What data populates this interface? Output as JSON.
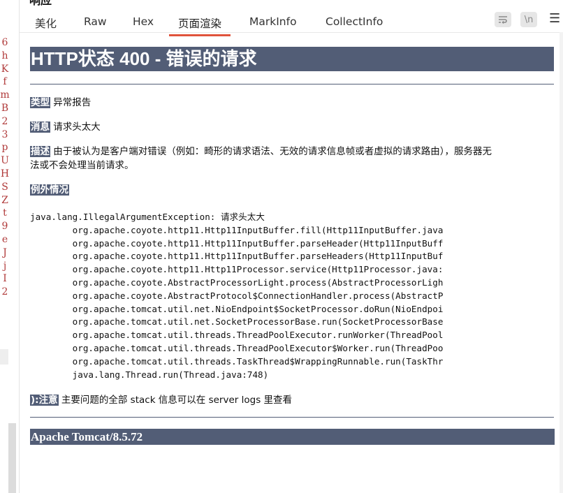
{
  "panel": {
    "title": "响应",
    "tabs": [
      {
        "label": "美化",
        "active": false
      },
      {
        "label": "Raw",
        "active": false
      },
      {
        "label": "Hex",
        "active": false
      },
      {
        "label": "页面渲染",
        "active": true
      },
      {
        "label": "MarkInfo",
        "active": false
      },
      {
        "label": "CollectInfo",
        "active": false
      }
    ],
    "tools": {
      "wrap_icon": "wrap-icon",
      "newline_label": "\\n",
      "menu_icon": "menu-icon"
    }
  },
  "gutter": [
    "6",
    "h",
    "K",
    "f",
    "m",
    "B",
    "2",
    "3",
    "p",
    "U",
    "H",
    "S",
    "Z",
    "t",
    "9",
    "e",
    "J",
    "j",
    "I",
    "2"
  ],
  "page": {
    "heading": "HTTP状态 400 - 错误的请求",
    "type_label": "类型",
    "type_value": "异常报告",
    "message_label": "消息",
    "message_value": "请求头太大",
    "desc_label": "描述",
    "desc_line1": "由于被认为是客户端对错误（例如：畸形的请求语法、无效的请求信息帧或者虚拟的请求路由），服务器无",
    "desc_line2": "法或不会处理当前请求。",
    "exception_label": "例外情况",
    "trace": [
      "java.lang.IllegalArgumentException: 请求头太大",
      "        org.apache.coyote.http11.Http11InputBuffer.fill(Http11InputBuffer.java",
      "        org.apache.coyote.http11.Http11InputBuffer.parseHeader(Http11InputBuff",
      "        org.apache.coyote.http11.Http11InputBuffer.parseHeaders(Http11InputBuf",
      "        org.apache.coyote.http11.Http11Processor.service(Http11Processor.java:",
      "        org.apache.coyote.AbstractProcessorLight.process(AbstractProcessorLigh",
      "        org.apache.coyote.AbstractProtocol$ConnectionHandler.process(AbstractP",
      "        org.apache.tomcat.util.net.NioEndpoint$SocketProcessor.doRun(NioEndpoi",
      "        org.apache.tomcat.util.net.SocketProcessorBase.run(SocketProcessorBase",
      "        org.apache.tomcat.util.threads.ThreadPoolExecutor.runWorker(ThreadPool",
      "        org.apache.tomcat.util.threads.ThreadPoolExecutor$Worker.run(ThreadPoo",
      "        org.apache.tomcat.util.threads.TaskThread$WrappingRunnable.run(TaskThr",
      "        java.lang.Thread.run(Thread.java:748)"
    ],
    "note_label": "):注意",
    "note_value": "主要问题的全部 stack 信息可以在 server logs 里查看",
    "footer": "Apache Tomcat/8.5.72"
  },
  "colors": {
    "heading_bg": "#525d76",
    "active_tab_underline": "#e0533c",
    "gutter_text": "#b03a3a"
  }
}
